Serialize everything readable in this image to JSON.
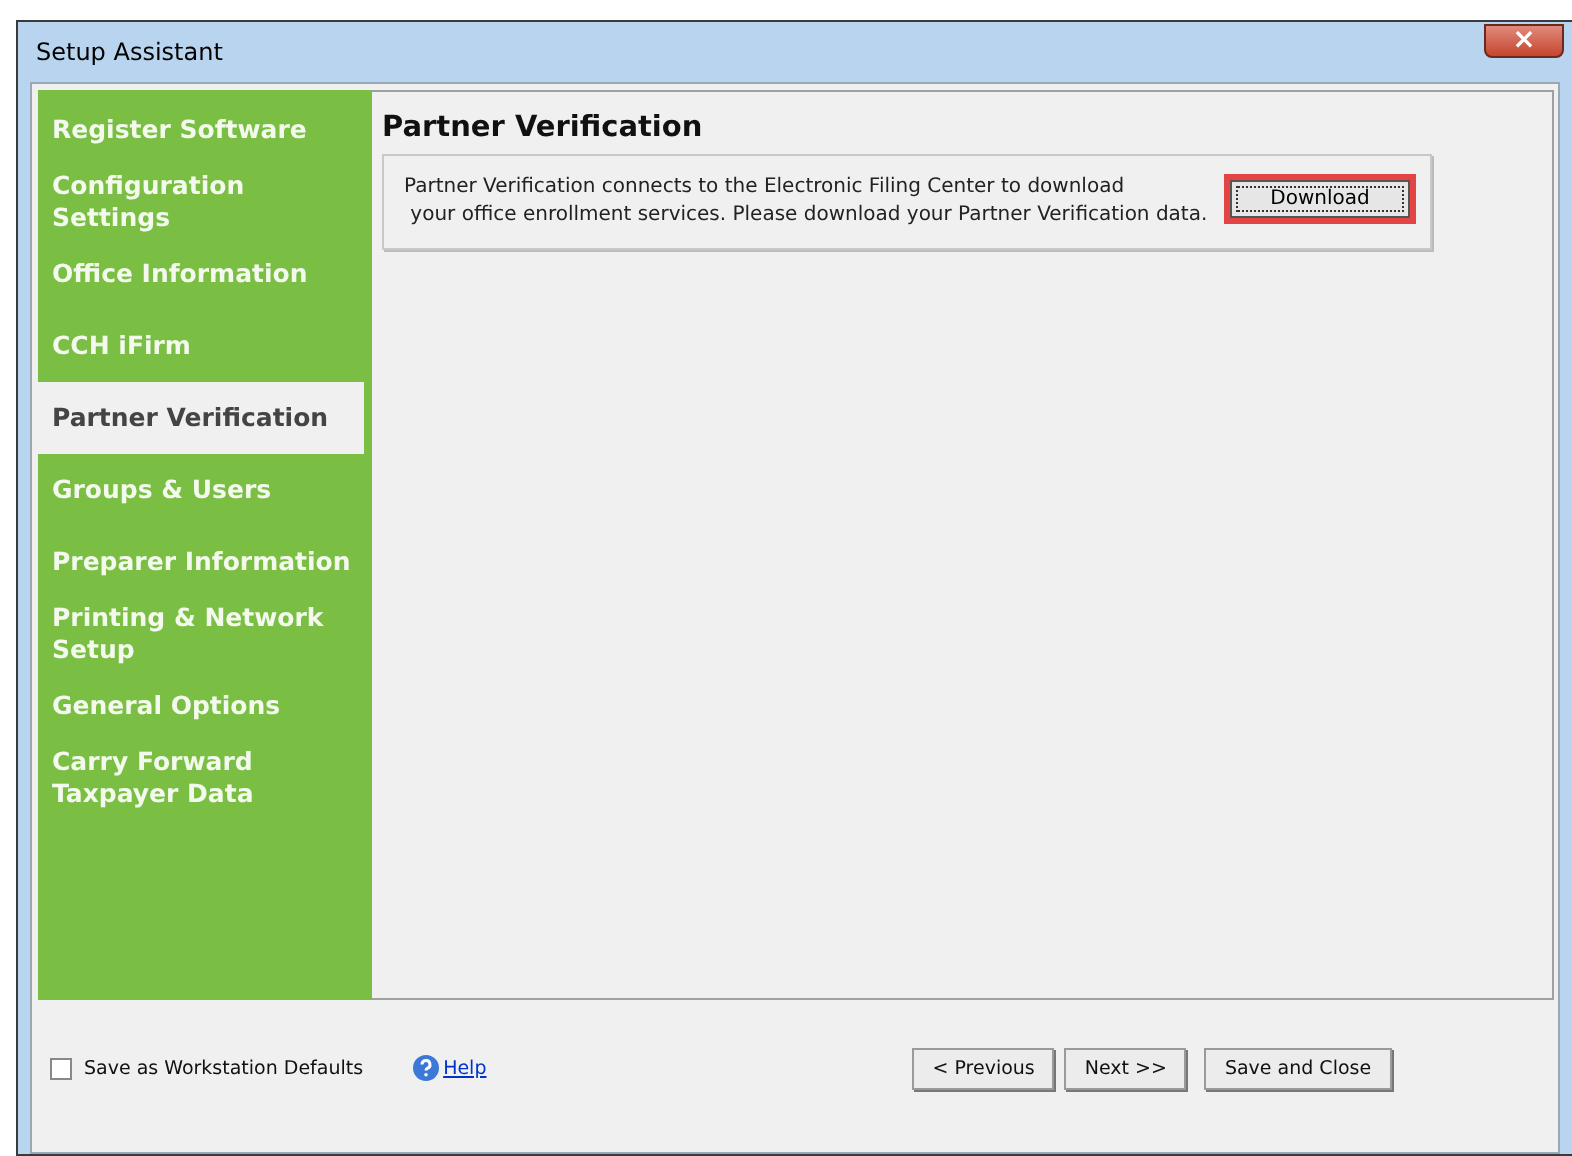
{
  "window": {
    "title": "Setup Assistant",
    "close_label": "×"
  },
  "sidebar": {
    "items": [
      {
        "label": "Register Software",
        "selected": false
      },
      {
        "label": "Configuration Settings",
        "selected": false
      },
      {
        "label": "Office Information",
        "selected": false
      },
      {
        "label": "CCH iFirm",
        "selected": false
      },
      {
        "label": "Partner Verification",
        "selected": true
      },
      {
        "label": "Groups & Users",
        "selected": false
      },
      {
        "label": "Preparer Information",
        "selected": false
      },
      {
        "label": "Printing & Network Setup",
        "selected": false
      },
      {
        "label": "General Options",
        "selected": false
      },
      {
        "label": "Carry Forward Taxpayer Data",
        "selected": false
      }
    ]
  },
  "content": {
    "heading": "Partner Verification",
    "description_lines": [
      "Partner Verification connects to the Electronic Filing Center to download",
      " your office enrollment services. Please download your Partner Verification data."
    ],
    "download_button": {
      "label": "Download",
      "highlighted": true
    }
  },
  "footer": {
    "workstation_defaults": {
      "label": "Save as Workstation Defaults",
      "checked": false
    },
    "help_link": "Help",
    "buttons": [
      "< Previous",
      "Next >>",
      "Save and Close"
    ]
  }
}
